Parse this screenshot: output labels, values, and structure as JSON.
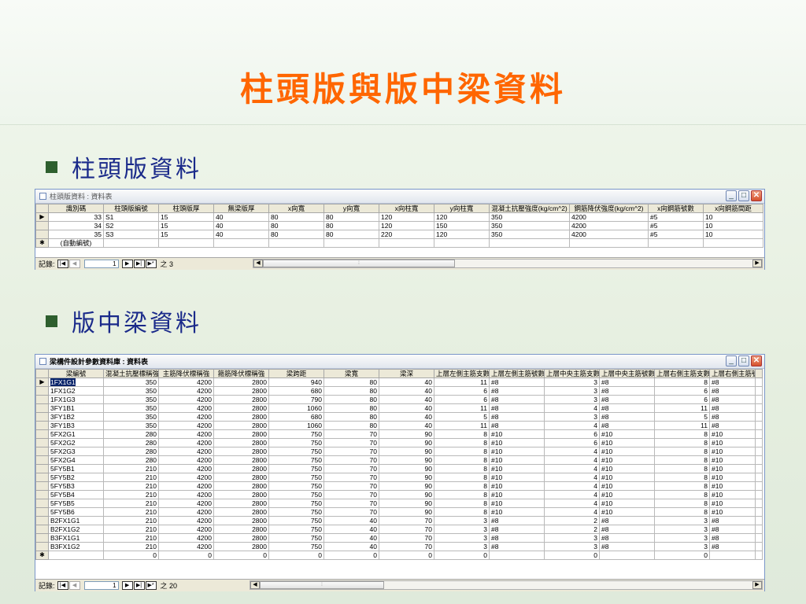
{
  "slide": {
    "title": "柱頭版與版中梁資料",
    "bullet1": "柱頭版資料",
    "bullet2": "版中梁資料"
  },
  "window1": {
    "title": "柱頭版資料 : 資料表",
    "columns": [
      "識別碼",
      "柱頭版編號",
      "柱頭版厚",
      "無梁版厚",
      "x向寬",
      "y向寬",
      "x向柱寬",
      "y向柱寬",
      "混凝土抗壓強度(kg/cm^2)",
      "鋼筋降伏強度(kg/cm^2)",
      "x向鋼筋號數",
      "x向鋼筋間距"
    ],
    "rows": [
      [
        "33",
        "S1",
        "15",
        "40",
        "80",
        "80",
        "120",
        "120",
        "350",
        "4200",
        "#5",
        "10"
      ],
      [
        "34",
        "S2",
        "15",
        "40",
        "80",
        "80",
        "120",
        "150",
        "350",
        "4200",
        "#5",
        "10"
      ],
      [
        "35",
        "S3",
        "15",
        "40",
        "80",
        "80",
        "220",
        "120",
        "350",
        "4200",
        "#5",
        "10"
      ]
    ],
    "new_row_placeholder": "(自動編號)",
    "nav": {
      "label": "記錄:",
      "current": "1",
      "total_text": "之 3"
    }
  },
  "window2": {
    "title": "梁構件設計參數資料庫 : 資料表",
    "columns": [
      "梁編號",
      "混凝土抗壓標稱強",
      "主筋降伏標稱強",
      "箍筋降伏標稱強",
      "梁跨距",
      "梁寬",
      "梁深",
      "上層左側主筋支數",
      "上層左側主筋號數",
      "上層中央主筋支數",
      "上層中央主筋號數",
      "上層右側主筋支數",
      "上層右側主筋號數"
    ],
    "rows": [
      [
        "1FX1G1",
        "350",
        "4200",
        "2800",
        "940",
        "80",
        "40",
        "11",
        "#8",
        "3",
        "#8",
        "8",
        "#8"
      ],
      [
        "1FX1G2",
        "350",
        "4200",
        "2800",
        "680",
        "80",
        "40",
        "6",
        "#8",
        "3",
        "#8",
        "6",
        "#8"
      ],
      [
        "1FX1G3",
        "350",
        "4200",
        "2800",
        "790",
        "80",
        "40",
        "6",
        "#8",
        "3",
        "#8",
        "6",
        "#8"
      ],
      [
        "3FY1B1",
        "350",
        "4200",
        "2800",
        "1060",
        "80",
        "40",
        "11",
        "#8",
        "4",
        "#8",
        "11",
        "#8"
      ],
      [
        "3FY1B2",
        "350",
        "4200",
        "2800",
        "680",
        "80",
        "40",
        "5",
        "#8",
        "3",
        "#8",
        "5",
        "#8"
      ],
      [
        "3FY1B3",
        "350",
        "4200",
        "2800",
        "1060",
        "80",
        "40",
        "11",
        "#8",
        "4",
        "#8",
        "11",
        "#8"
      ],
      [
        "5FX2G1",
        "280",
        "4200",
        "2800",
        "750",
        "70",
        "90",
        "8",
        "#10",
        "6",
        "#10",
        "8",
        "#10"
      ],
      [
        "5FX2G2",
        "280",
        "4200",
        "2800",
        "750",
        "70",
        "90",
        "8",
        "#10",
        "6",
        "#10",
        "8",
        "#10"
      ],
      [
        "5FX2G3",
        "280",
        "4200",
        "2800",
        "750",
        "70",
        "90",
        "8",
        "#10",
        "4",
        "#10",
        "8",
        "#10"
      ],
      [
        "5FX2G4",
        "280",
        "4200",
        "2800",
        "750",
        "70",
        "90",
        "8",
        "#10",
        "4",
        "#10",
        "8",
        "#10"
      ],
      [
        "5FY5B1",
        "210",
        "4200",
        "2800",
        "750",
        "70",
        "90",
        "8",
        "#10",
        "4",
        "#10",
        "8",
        "#10"
      ],
      [
        "5FY5B2",
        "210",
        "4200",
        "2800",
        "750",
        "70",
        "90",
        "8",
        "#10",
        "4",
        "#10",
        "8",
        "#10"
      ],
      [
        "5FY5B3",
        "210",
        "4200",
        "2800",
        "750",
        "70",
        "90",
        "8",
        "#10",
        "4",
        "#10",
        "8",
        "#10"
      ],
      [
        "5FY5B4",
        "210",
        "4200",
        "2800",
        "750",
        "70",
        "90",
        "8",
        "#10",
        "4",
        "#10",
        "8",
        "#10"
      ],
      [
        "5FY5B5",
        "210",
        "4200",
        "2800",
        "750",
        "70",
        "90",
        "8",
        "#10",
        "4",
        "#10",
        "8",
        "#10"
      ],
      [
        "5FY5B6",
        "210",
        "4200",
        "2800",
        "750",
        "70",
        "90",
        "8",
        "#10",
        "4",
        "#10",
        "8",
        "#10"
      ],
      [
        "B2FX1G1",
        "210",
        "4200",
        "2800",
        "750",
        "40",
        "70",
        "3",
        "#8",
        "2",
        "#8",
        "3",
        "#8"
      ],
      [
        "B2FX1G2",
        "210",
        "4200",
        "2800",
        "750",
        "40",
        "70",
        "3",
        "#8",
        "2",
        "#8",
        "3",
        "#8"
      ],
      [
        "B3FX1G1",
        "210",
        "4200",
        "2800",
        "750",
        "40",
        "70",
        "3",
        "#8",
        "3",
        "#8",
        "3",
        "#8"
      ],
      [
        "B3FX1G2",
        "210",
        "4200",
        "2800",
        "750",
        "40",
        "70",
        "3",
        "#8",
        "3",
        "#8",
        "3",
        "#8"
      ]
    ],
    "new_row": [
      "",
      "0",
      "0",
      "0",
      "0",
      "0",
      "0",
      "0",
      "",
      "0",
      "",
      "0",
      ""
    ],
    "nav": {
      "label": "記錄:",
      "current": "1",
      "total_text": "之 20"
    }
  }
}
